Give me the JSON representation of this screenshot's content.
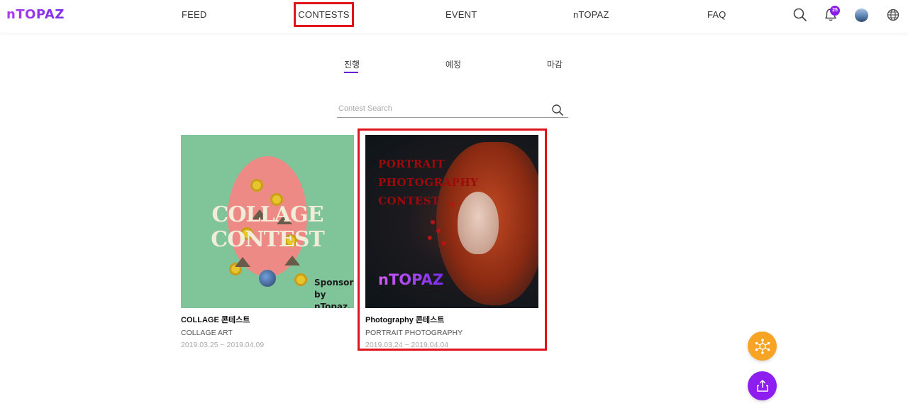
{
  "header": {
    "logo": "nTOPAZ",
    "nav": [
      "FEED",
      "CONTESTS",
      "EVENT",
      "nTOPAZ",
      "FAQ"
    ],
    "notification_count": "25",
    "icons": [
      "search-icon",
      "bell-icon",
      "avatar",
      "globe-icon"
    ]
  },
  "tabs": [
    "진행",
    "예정",
    "마감"
  ],
  "search": {
    "placeholder": "Contest Search"
  },
  "contests": [
    {
      "title": "COLLAGE 콘테스트",
      "subtitle": "COLLAGE ART",
      "dates": "2019.03.25 ~ 2019.04.09",
      "image_text": "COLLAGE CONTEST",
      "image_sponsor": "Sponsored by nTopaz."
    },
    {
      "title": "Photography 콘테스트",
      "subtitle": "PORTRAIT PHOTOGRAPHY",
      "dates": "2019.03.24 ~ 2019.04.04",
      "image_text": "PORTRAIT PHOTOGRAPHY CONTEST",
      "image_logo": "nTOPAZ"
    }
  ],
  "colors": {
    "accent": "#8e1ef0",
    "highlight": "#e0141b",
    "fab_orange": "#f7a425"
  }
}
